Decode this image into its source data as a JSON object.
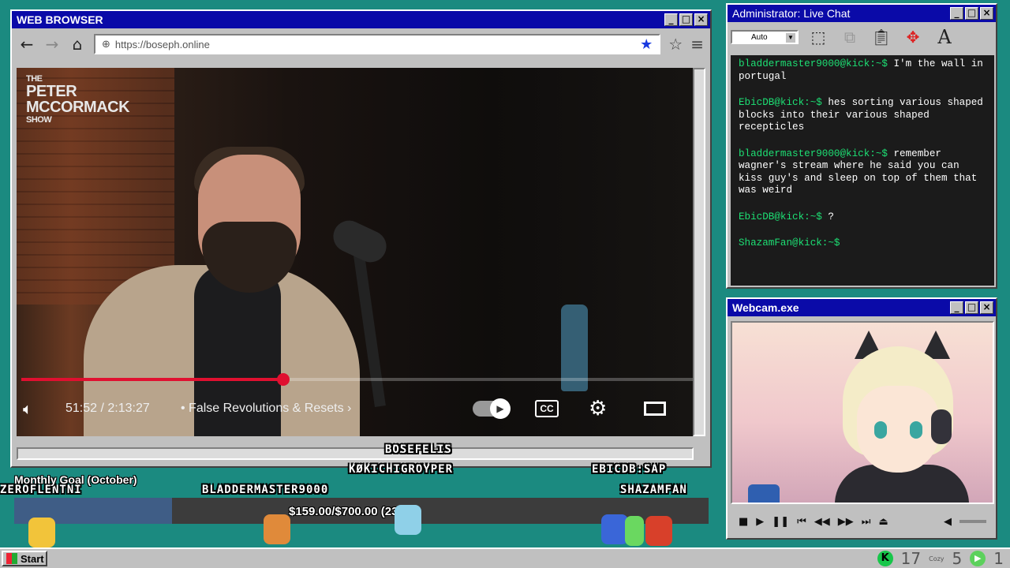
{
  "browser": {
    "title": "WEB BROWSER",
    "url": "https://boseph.online",
    "video": {
      "show_logo_line1": "THE",
      "show_logo_line2": "PETER",
      "show_logo_line3": "MCCORMACK",
      "show_logo_line4": "SHOW",
      "time": "51:52 / 2:13:27",
      "chapter": "• False Revolutions & Resets",
      "chapter_arrow": "›",
      "cc_label": "CC",
      "progress_fraction": 0.39
    }
  },
  "chat": {
    "title": "Administrator: Live Chat",
    "font_size_select": "Auto",
    "messages": [
      {
        "user": "bladdermaster9000@kick:~$",
        "text": " I'm the wall in portugal"
      },
      {
        "user": "EbicDB@kick:~$",
        "text": " hes sorting various shaped blocks into their various shaped recepticles"
      },
      {
        "user": "bladdermaster9000@kick:~$",
        "text": " remember wagner's stream where he said you can kiss guy's and sleep on top of them that was weird"
      },
      {
        "user": "EbicDB@kick:~$",
        "text": " ?"
      },
      {
        "user": "ShazamFan@kick:~$",
        "text": ""
      }
    ]
  },
  "webcam": {
    "title": "Webcam.exe"
  },
  "overlay": {
    "names": {
      "bosefelis": "BOSEFELIS",
      "kokichi": "KØKICHIGROYPER",
      "ebicdb": "EBICDB:SAP",
      "zeroflentni": "ZEROFLENTNI",
      "bladdermaster": "BLADDERMASTER9000",
      "shazamfan": "SHAZAMFAN"
    },
    "goal_title": "Monthly Goal (October)",
    "goal_amount": "$159.00/$700.00 (23%)",
    "goal_fraction": 0.227
  },
  "taskbar": {
    "start_label": "Start",
    "tray_num1": "17",
    "tray_num2": "5",
    "tray_num3": "1",
    "tray_small": "Cozy"
  },
  "colors": {
    "desktop": "#1b8a80",
    "titlebar": "#0a0aa8",
    "chat_username": "#1de074",
    "progress": "#e01030"
  }
}
